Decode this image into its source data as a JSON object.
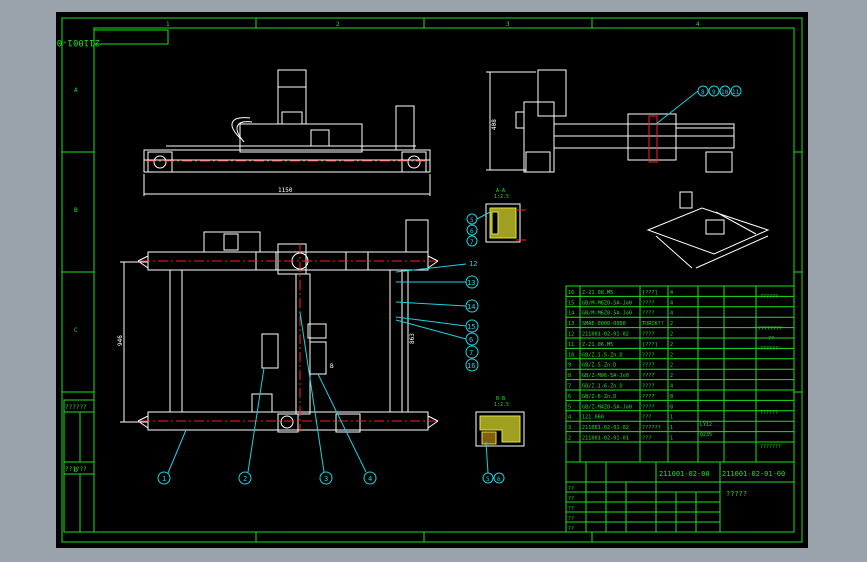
{
  "drawing": {
    "code_rotated": "211001-02-01-00",
    "border_marks": [
      "1",
      "2",
      "3",
      "4",
      "A",
      "B",
      "C",
      "D"
    ],
    "dim_width": "1150",
    "dim_height_side": "408",
    "dim_left": "946",
    "dim_right": "863",
    "section_aa": "A-A",
    "section_aa_scale": "1:2.5",
    "section_bb": "B-B",
    "section_bb_scale": "1:2.5",
    "view_label": "B",
    "top_callouts": [
      "8",
      "9",
      "10",
      "11"
    ],
    "left_panel": [
      "??????",
      "??????"
    ]
  },
  "callouts_left": [
    "5",
    "6",
    "7"
  ],
  "callouts_bottom": [
    "1",
    "2",
    "3",
    "4"
  ],
  "callouts_right": [
    "12",
    "13",
    "14",
    "15",
    "6",
    "7",
    "16"
  ],
  "callouts_bb": [
    "5",
    "6"
  ],
  "bom": [
    [
      "16",
      "Z-21.08.M5",
      "[???]",
      "4"
    ],
    [
      "15",
      "GB/M-M6Z0-5A-Jo0",
      "????",
      "4"
    ],
    [
      "14",
      "GB/M-M6Z0-5A-Jo0",
      "????",
      "4"
    ],
    [
      "13",
      "SMAE-0000-0000",
      "TURCK??",
      "2"
    ],
    [
      "12",
      "211001-02-01-02",
      "????",
      "2"
    ],
    [
      "11",
      "Z-21.06.M5",
      "[???]",
      "2"
    ],
    [
      "10",
      "GB/Z.1-5-Zn.D",
      "????",
      "2"
    ],
    [
      "9",
      "GB/Z-5-Zn.D",
      "????",
      "2"
    ],
    [
      "8",
      "GB/Z-M06-5A-Jo0",
      "????",
      "2"
    ],
    [
      "7",
      "GB/Z.1-6-Zn.D",
      "????",
      "4"
    ],
    [
      "6",
      "GB/Z-6-Zn.D",
      "????",
      "8"
    ],
    [
      "5",
      "GB/Z-M4Z0-5A-Jo0",
      "????",
      "8"
    ],
    [
      "4",
      "121.060",
      "???",
      "1"
    ],
    [
      "3",
      "211001-02-01-02",
      "??????",
      "1"
    ],
    [
      "2",
      "211001-02-01-01",
      "???",
      "1"
    ]
  ],
  "bom_right_notes": [
    "??????",
    "????????",
    "??????",
    "??",
    "??????",
    "???????"
  ],
  "bom_right_notes2": [
    "LY12",
    "Q235"
  ],
  "title_block": {
    "drawing_no": "211001-02-00",
    "drawing_no_main": "211001-02-01-00",
    "name": "?????",
    "marks": [
      "??",
      "??",
      "??",
      "??",
      "??"
    ]
  }
}
